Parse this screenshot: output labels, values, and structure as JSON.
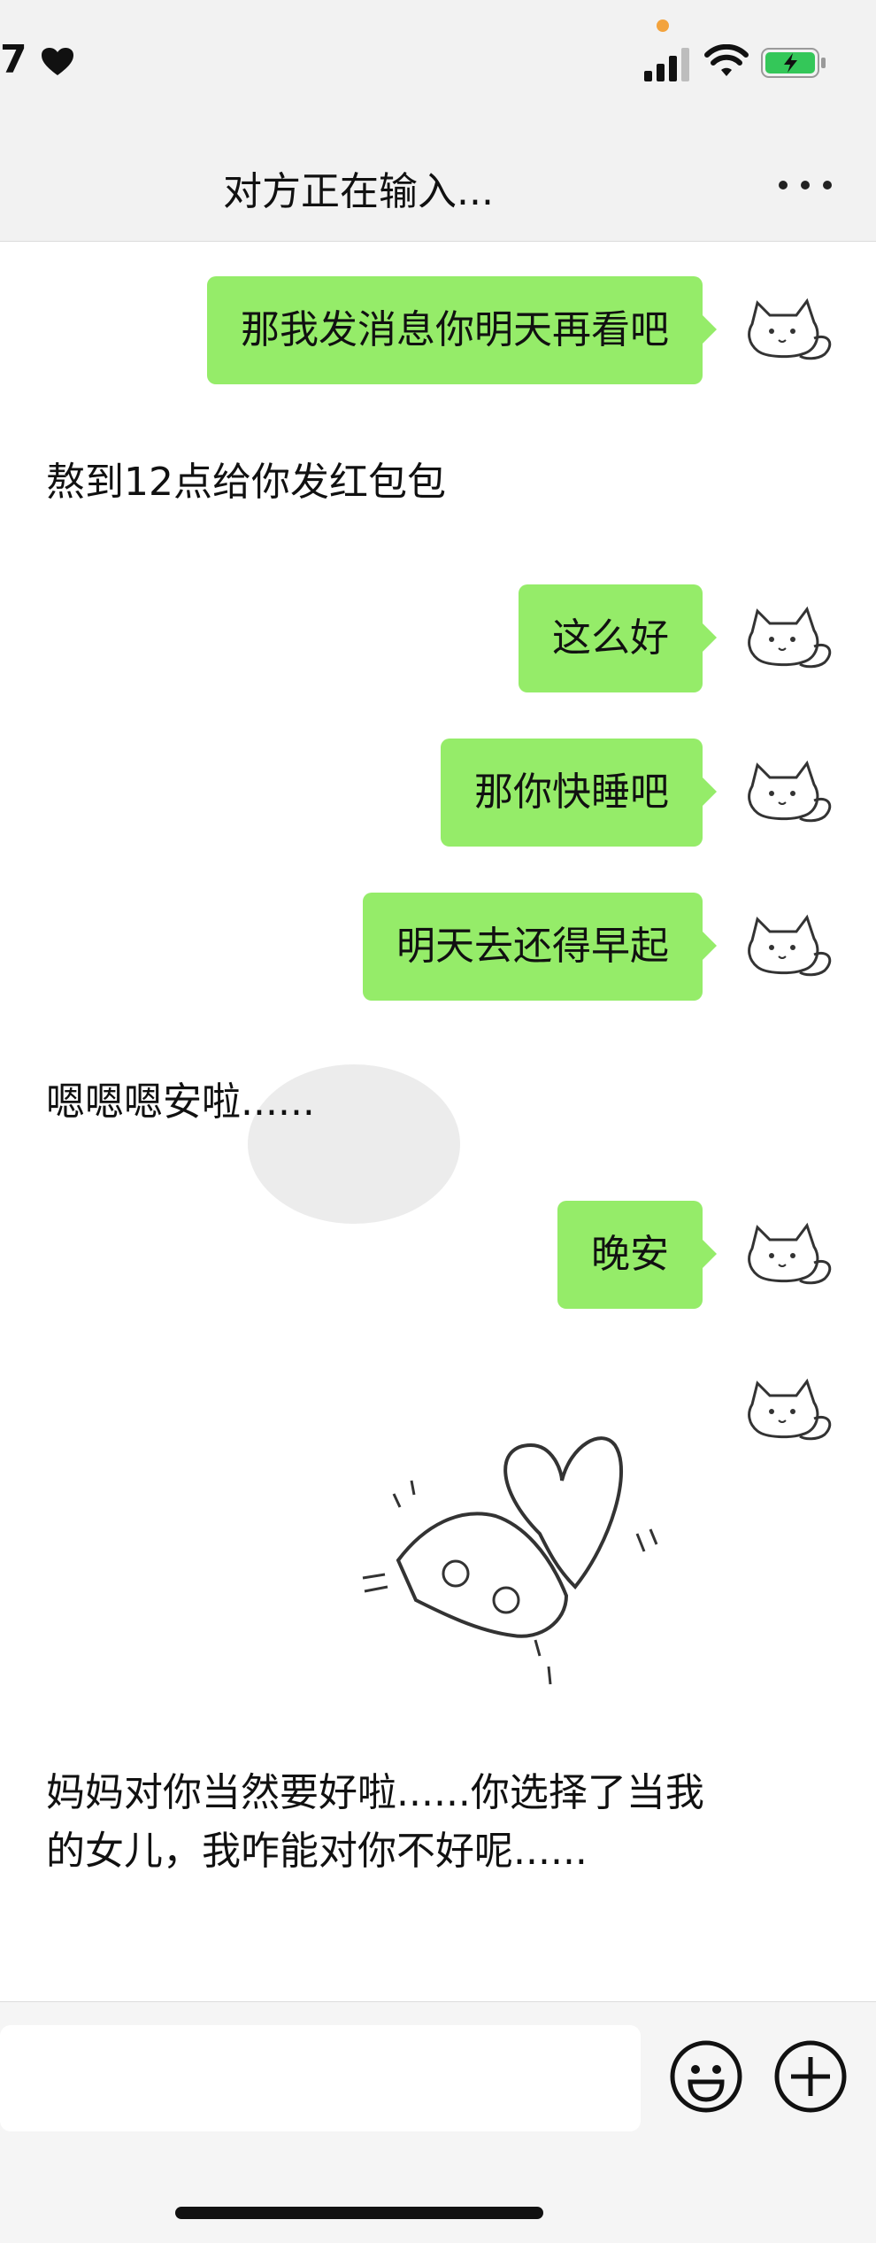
{
  "status": {
    "time": "7",
    "accent_dot_color": "#f3a33d",
    "battery_color": "#34c759"
  },
  "nav": {
    "title": "对方正在输入...",
    "more_icon": "more-horizontal-icon"
  },
  "messages": [
    {
      "side": "out",
      "text": "那我发消息你明天再看吧"
    },
    {
      "side": "in",
      "text": "熬到12点给你发红包包"
    },
    {
      "side": "out",
      "text": "这么好"
    },
    {
      "side": "out",
      "text": "那你快睡吧"
    },
    {
      "side": "out",
      "text": "明天去还得早起"
    },
    {
      "side": "in",
      "text": "嗯嗯嗯安啦......"
    },
    {
      "side": "out",
      "text": "晚安"
    },
    {
      "side": "out",
      "sticker": "cat-heart-sticker"
    },
    {
      "side": "in",
      "text": "妈妈对你当然要好啦......你选择了当我的女儿，我咋能对你不好呢......"
    }
  ],
  "input": {
    "emoji_icon": "emoji-icon",
    "plus_icon": "plus-icon"
  },
  "colors": {
    "outgoing_bubble": "#95ec69",
    "header_bg": "#f2f2f2"
  }
}
